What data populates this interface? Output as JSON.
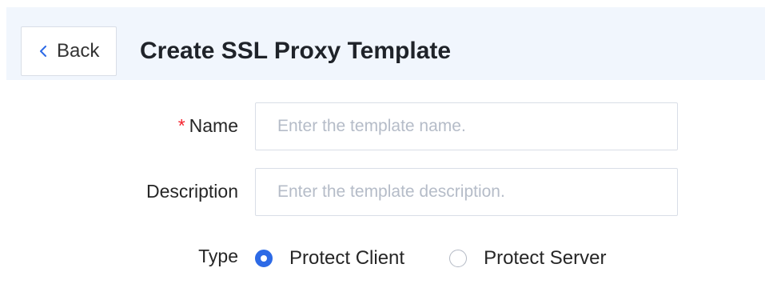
{
  "header": {
    "back_label": "Back",
    "title": "Create SSL Proxy Template"
  },
  "form": {
    "name": {
      "required_mark": "*",
      "label": "Name",
      "value": "",
      "placeholder": "Enter the template name."
    },
    "description": {
      "label": "Description",
      "value": "",
      "placeholder": "Enter the template description."
    },
    "type": {
      "label": "Type",
      "selected": "Protect Client",
      "options": [
        {
          "label": "Protect Client",
          "checked": true
        },
        {
          "label": "Protect Server",
          "checked": false
        }
      ]
    }
  },
  "colors": {
    "header_background": "#f1f6fd",
    "accent": "#2d6ae6",
    "required": "#f5222d",
    "placeholder": "#b5bcc8"
  },
  "icons": {
    "back": "chevron-left-icon"
  }
}
